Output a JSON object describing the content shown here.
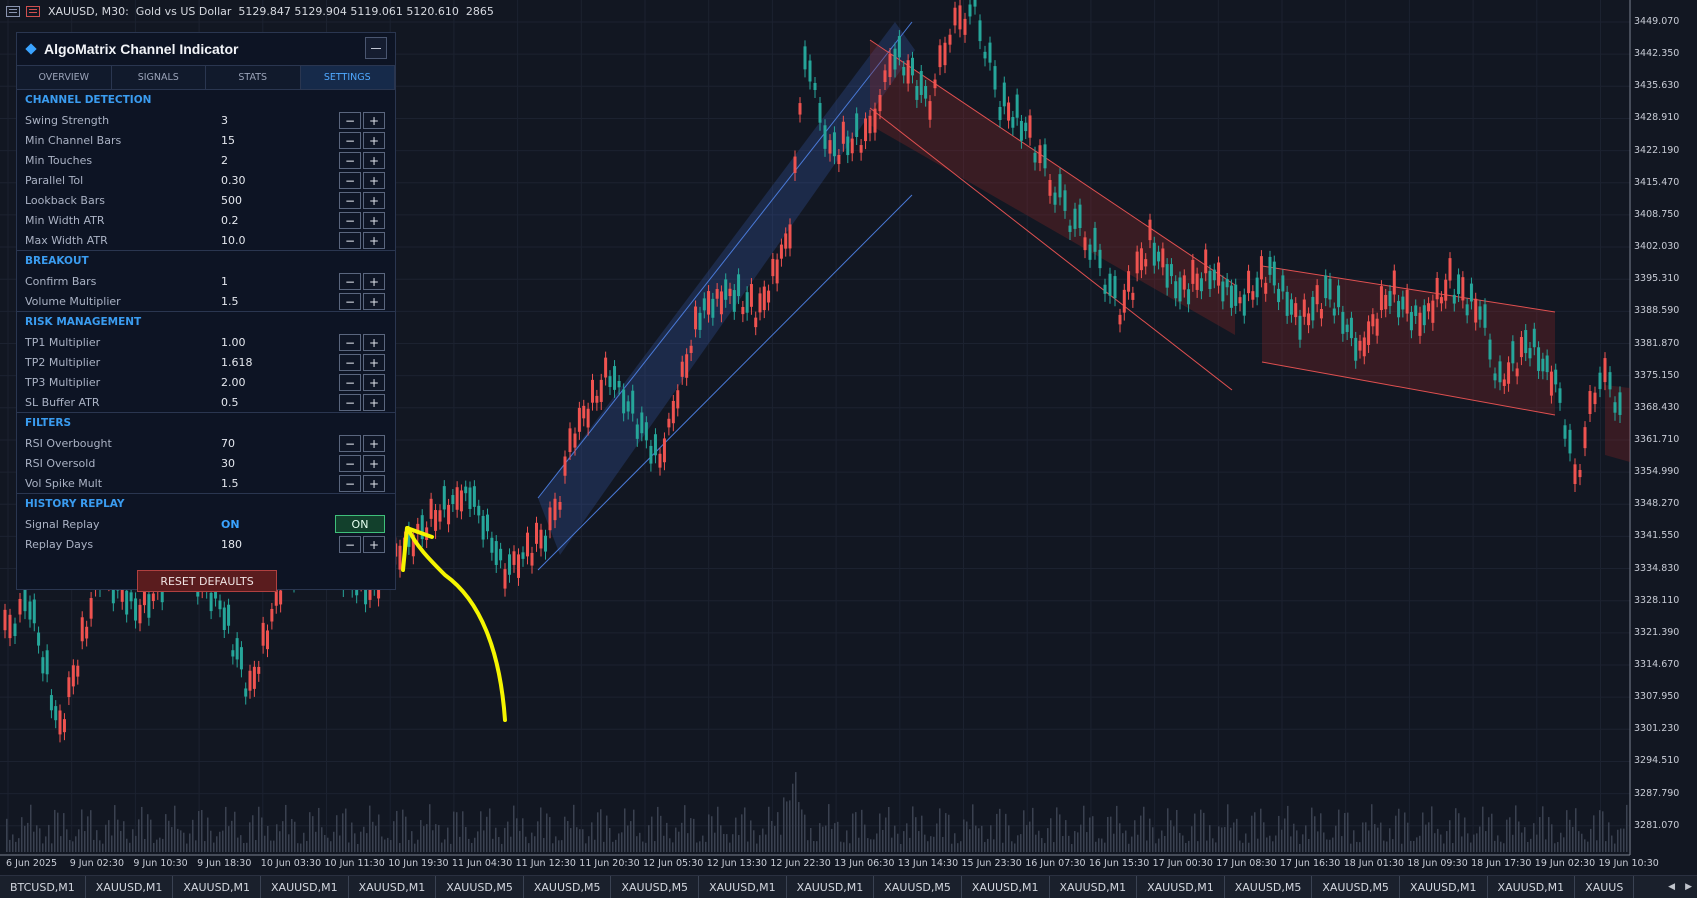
{
  "window": {
    "title": "XAUUSD, M30:  Gold vs US Dollar  5129.847 5129.904 5119.061 5120.610  2865"
  },
  "panel": {
    "title": "AlgoMatrix Channel Indicator",
    "tabs": [
      {
        "label": "OVERVIEW"
      },
      {
        "label": "SIGNALS"
      },
      {
        "label": "STATS"
      },
      {
        "label": "SETTINGS"
      }
    ],
    "active_tab": "SETTINGS",
    "sections": [
      {
        "title": "CHANNEL DETECTION",
        "rows": [
          {
            "label": "Swing Strength",
            "value": "3"
          },
          {
            "label": "Min Channel Bars",
            "value": "15"
          },
          {
            "label": "Min Touches",
            "value": "2"
          },
          {
            "label": "Parallel Tol",
            "value": "0.30"
          },
          {
            "label": "Lookback Bars",
            "value": "500"
          },
          {
            "label": "Min Width ATR",
            "value": "0.2"
          },
          {
            "label": "Max Width ATR",
            "value": "10.0"
          }
        ]
      },
      {
        "title": "BREAKOUT",
        "rows": [
          {
            "label": "Confirm Bars",
            "value": "1"
          },
          {
            "label": "Volume Multiplier",
            "value": "1.5"
          }
        ]
      },
      {
        "title": "RISK MANAGEMENT",
        "rows": [
          {
            "label": "TP1 Multiplier",
            "value": "1.00"
          },
          {
            "label": "TP2 Multiplier",
            "value": "1.618"
          },
          {
            "label": "TP3 Multiplier",
            "value": "2.00"
          },
          {
            "label": "SL Buffer ATR",
            "value": "0.5"
          }
        ]
      },
      {
        "title": "FILTERS",
        "rows": [
          {
            "label": "RSI Overbought",
            "value": "70"
          },
          {
            "label": "RSI Oversold",
            "value": "30"
          },
          {
            "label": "Vol Spike Mult",
            "value": "1.5"
          }
        ]
      },
      {
        "title": "HISTORY REPLAY",
        "rows": [
          {
            "label": "Signal Replay",
            "value": "ON",
            "toggle": "ON"
          },
          {
            "label": "Replay Days",
            "value": "180"
          }
        ]
      }
    ],
    "stepper_minus": "−",
    "stepper_plus": "+",
    "reset_label": "RESET DEFAULTS"
  },
  "price_axis": [
    "3449.070",
    "3442.350",
    "3435.630",
    "3428.910",
    "3422.190",
    "3415.470",
    "3408.750",
    "3402.030",
    "3395.310",
    "3388.590",
    "3381.870",
    "3375.150",
    "3368.430",
    "3361.710",
    "3354.990",
    "3348.270",
    "3341.550",
    "3334.830",
    "3328.110",
    "3321.390",
    "3314.670",
    "3307.950",
    "3301.230",
    "3294.510",
    "3287.790",
    "3281.070"
  ],
  "time_axis": [
    "6 Jun 2025",
    "9 Jun 02:30",
    "9 Jun 10:30",
    "9 Jun 18:30",
    "10 Jun 03:30",
    "10 Jun 11:30",
    "10 Jun 19:30",
    "11 Jun 04:30",
    "11 Jun 12:30",
    "11 Jun 20:30",
    "12 Jun 05:30",
    "12 Jun 13:30",
    "12 Jun 22:30",
    "13 Jun 06:30",
    "13 Jun 14:30",
    "15 Jun 23:30",
    "16 Jun 07:30",
    "16 Jun 15:30",
    "17 Jun 00:30",
    "17 Jun 08:30",
    "17 Jun 16:30",
    "18 Jun 01:30",
    "18 Jun 09:30",
    "18 Jun 17:30",
    "19 Jun 02:30",
    "19 Jun 10:30"
  ],
  "bottom_tabs": [
    "BTCUSD,M1",
    "XAUUSD,M1",
    "XAUUSD,M1",
    "XAUUSD,M1",
    "XAUUSD,M1",
    "XAUUSD,M5",
    "XAUUSD,M5",
    "XAUUSD,M5",
    "XAUUSD,M1",
    "XAUUSD,M1",
    "XAUUSD,M5",
    "XAUUSD,M1",
    "XAUUSD,M1",
    "XAUUSD,M1",
    "XAUUSD,M5",
    "XAUUSD,M5",
    "XAUUSD,M1",
    "XAUUSD,M1",
    "XAUUS"
  ],
  "colors": {
    "bull": "#26a69a",
    "bear": "#ef5350",
    "accent": "#3aa3ff",
    "annotation": "#f5f500"
  }
}
